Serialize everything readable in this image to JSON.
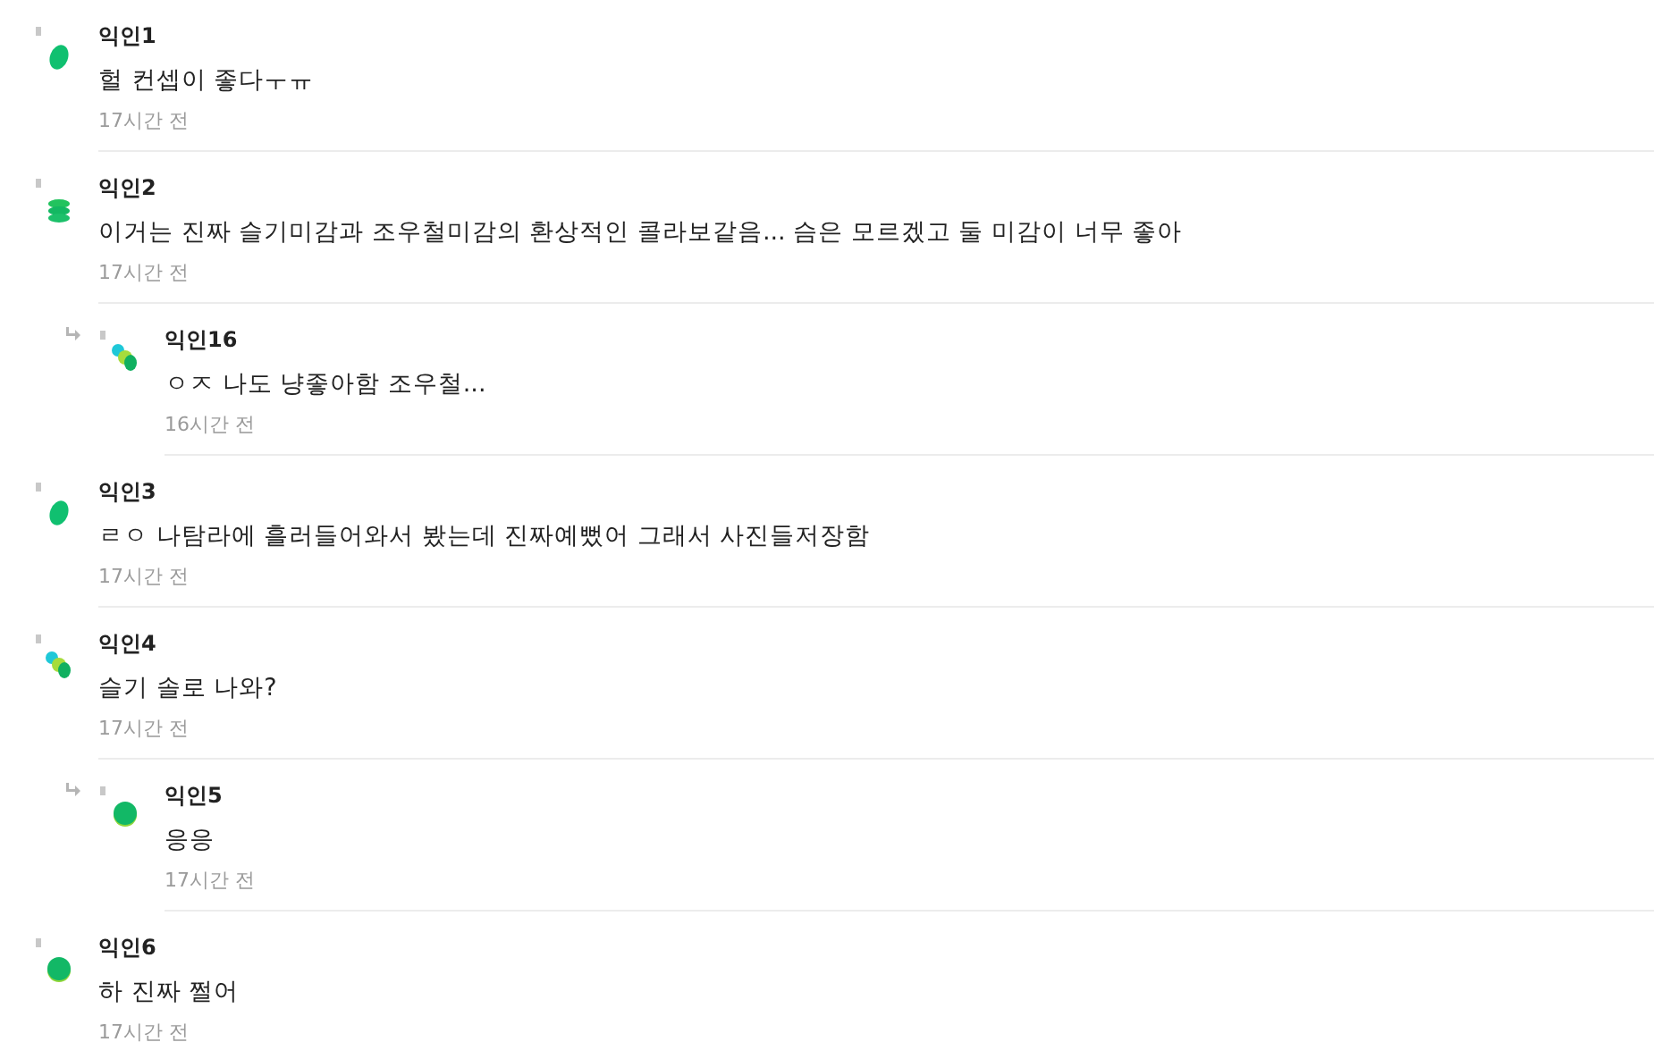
{
  "comments": [
    {
      "author": "익인1",
      "kind": "oval",
      "text": "헐 컨셉이 좋다ㅜㅠ",
      "time": "17시간 전"
    },
    {
      "author": "익인2",
      "kind": "stack",
      "text": "이거는 진짜 슬기미감과 조우철미감의 환상적인 콜라보같음... 슴은 모르겠고 둘 미감이 너무 좋아",
      "time": "17시간 전",
      "children": [
        {
          "author": "익인16",
          "kind": "dots",
          "text": "ㅇㅈ 나도 냥좋아함 조우철...",
          "time": "16시간 전"
        }
      ]
    },
    {
      "author": "익인3",
      "kind": "oval",
      "text": "ㄹㅇ 나탐라에 흘러들어와서 봤는데 진짜예뻤어 그래서 사진들저장함",
      "time": "17시간 전"
    },
    {
      "author": "익인4",
      "kind": "dots",
      "text": "슬기 솔로 나와?",
      "time": "17시간 전",
      "children": [
        {
          "author": "익인5",
          "kind": "round",
          "text": "응응",
          "time": "17시간 전"
        }
      ]
    },
    {
      "author": "익인6",
      "kind": "round",
      "text": "하 진짜 쩔어",
      "time": "17시간 전"
    }
  ]
}
